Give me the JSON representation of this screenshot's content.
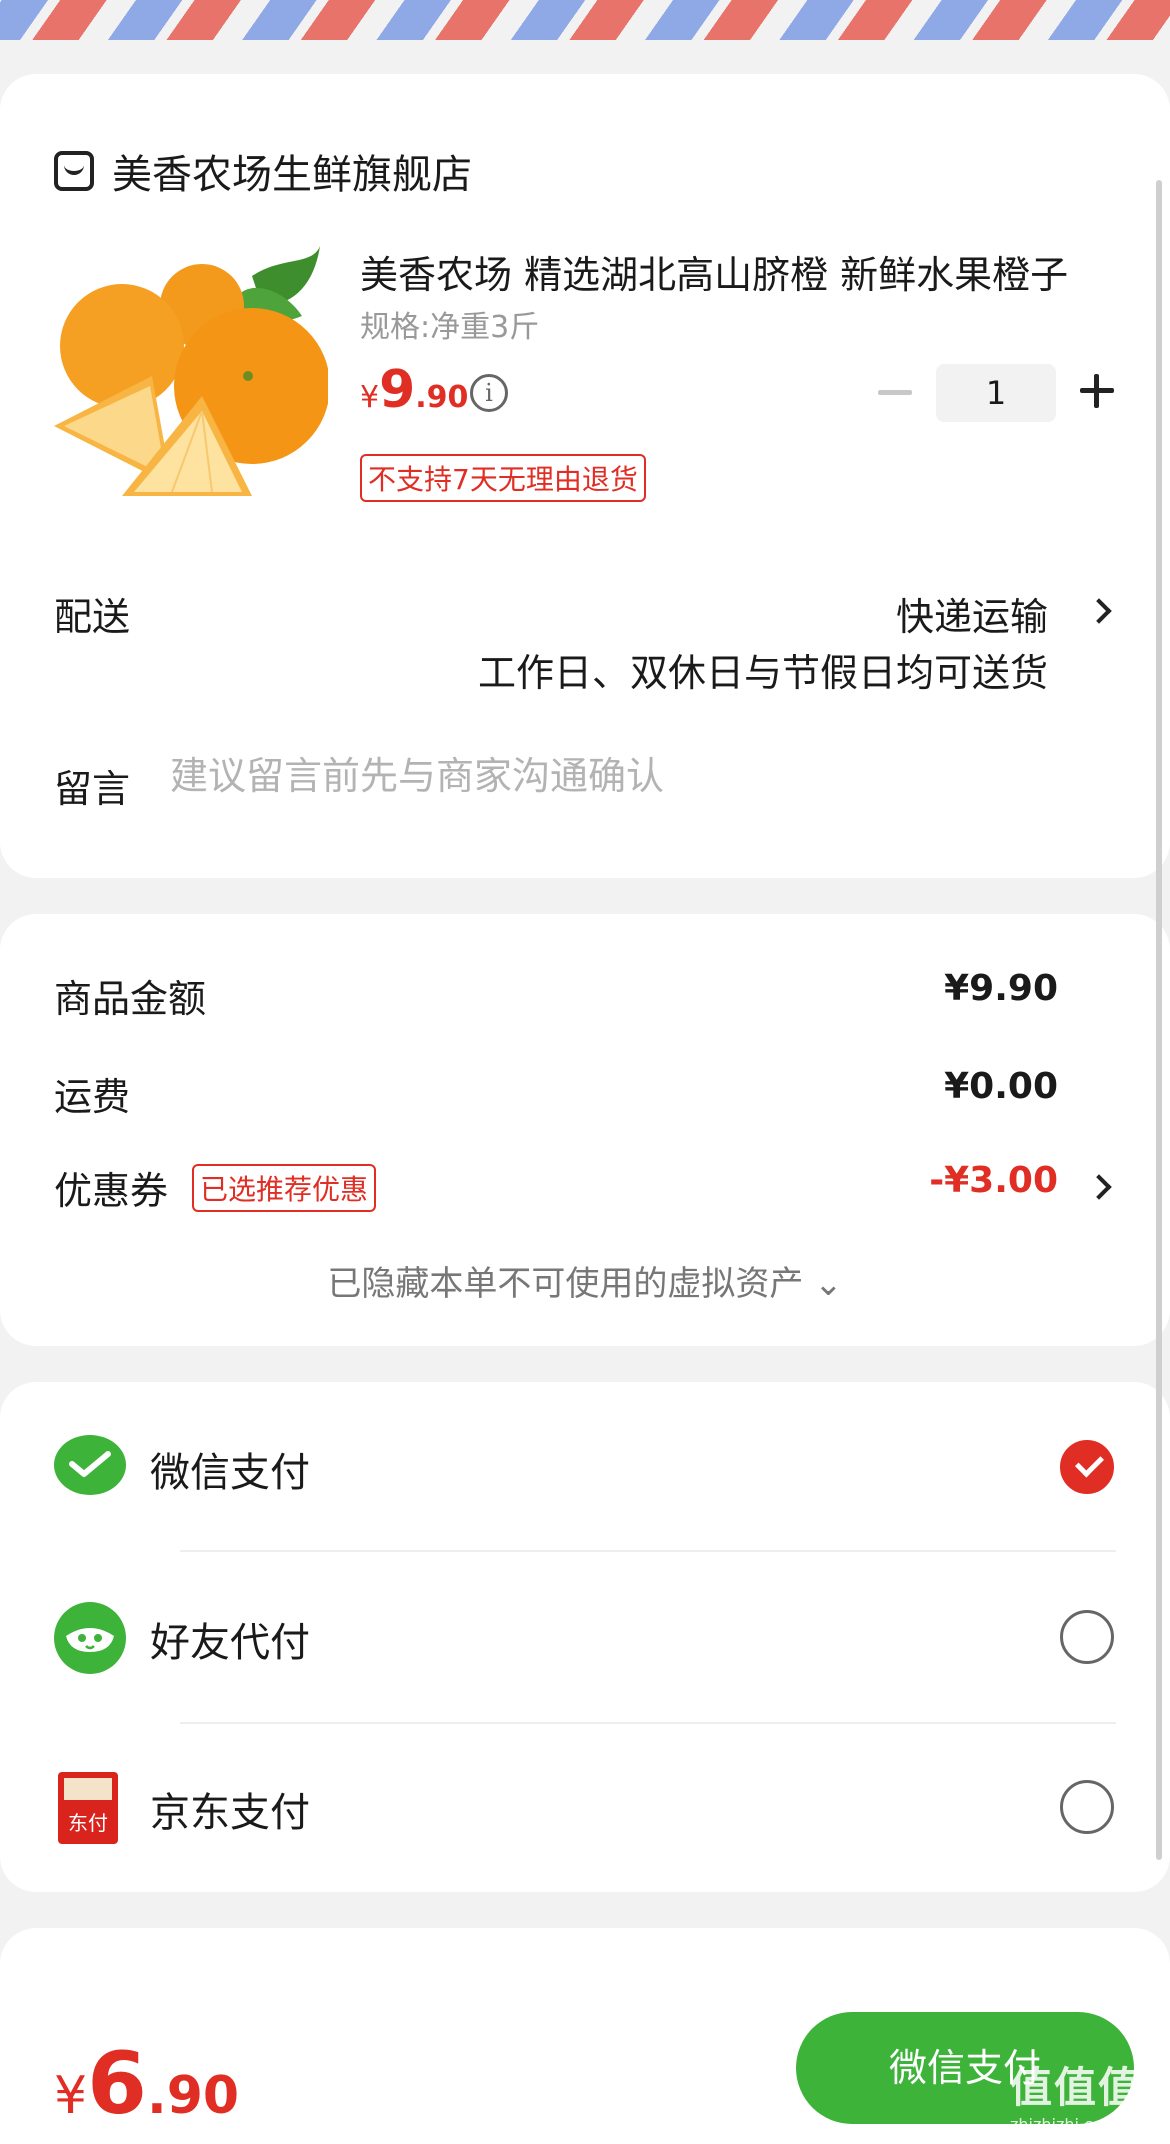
{
  "shop": {
    "name": "美香农场生鲜旗舰店"
  },
  "product": {
    "title": "美香农场 精选湖北高山脐橙 新鲜水果橙子",
    "spec": "规格:净重3斤",
    "price_currency": "¥",
    "price_int": "9",
    "price_dec": ".90",
    "quantity": "1",
    "return_policy": "不支持7天无理由退货"
  },
  "delivery": {
    "label": "配送",
    "method": "快递运输",
    "note": "工作日、双休日与节假日均可送货"
  },
  "message": {
    "label": "留言",
    "placeholder": "建议留言前先与商家沟通确认"
  },
  "amounts": {
    "goods_label": "商品金额",
    "goods_value": "¥9.90",
    "shipping_label": "运费",
    "shipping_value": "¥0.00",
    "coupon_label": "优惠券",
    "coupon_tag": "已选推荐优惠",
    "coupon_value": "-¥3.00",
    "hidden_assets": "已隐藏本单不可使用的虚拟资产 ⌄"
  },
  "payment_methods": [
    {
      "label": "微信支付",
      "icon": "wechat-pay-icon",
      "selected": true
    },
    {
      "label": "好友代付",
      "icon": "friend-pay-icon",
      "selected": false
    },
    {
      "label": "京东支付",
      "icon": "jd-pay-icon",
      "icon_text": "东付",
      "selected": false
    }
  ],
  "footer": {
    "total_currency": "¥",
    "total_int": "6",
    "total_dec": ".90",
    "pay_button": "微信支付"
  },
  "watermark": {
    "logo": "值值值",
    "url": "zhizhizhi.com"
  },
  "colors": {
    "accent_red": "#e02e24",
    "wechat_green": "#3db33a",
    "page_bg": "#f2f2f2"
  }
}
